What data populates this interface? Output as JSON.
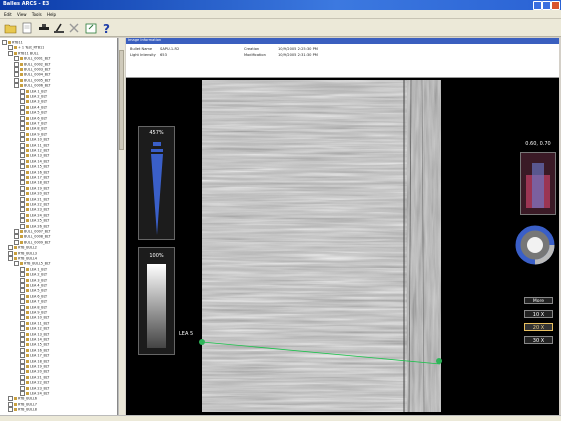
{
  "window": {
    "title": "Balles ARCS - E3"
  },
  "menu": [
    "Edit",
    "View",
    "Tools",
    "Help"
  ],
  "toolbar": {
    "icons": [
      "open-folder-icon",
      "new-document-icon",
      "stamp-icon",
      "tool-icon",
      "delete-icon",
      "export-icon",
      "help-icon"
    ]
  },
  "tree": {
    "items": [
      {
        "text": "RTB11",
        "indent": 0
      },
      {
        "text": "+ 1 Test_RTB11",
        "indent": 1
      },
      {
        "text": "RTB11 BULL",
        "indent": 1
      },
      {
        "text": "BULL_0001_BLT",
        "indent": 2
      },
      {
        "text": "BULL_0002_BLT",
        "indent": 2
      },
      {
        "text": "BULL_0003_BLT",
        "indent": 2
      },
      {
        "text": "BULL_0004_BLT",
        "indent": 2
      },
      {
        "text": "BULL_0005_BLT",
        "indent": 2
      },
      {
        "text": "BULL_0006_BLT",
        "indent": 2
      },
      {
        "text": "LEA 1_BLT",
        "indent": 3
      },
      {
        "text": "LEA 2_BLT",
        "indent": 3
      },
      {
        "text": "LEA 3_BLT",
        "indent": 3
      },
      {
        "text": "LEA 4_BLT",
        "indent": 3
      },
      {
        "text": "LEA 5_BLT",
        "indent": 3
      },
      {
        "text": "LEA 6_BLT",
        "indent": 3
      },
      {
        "text": "LEA 7_BLT",
        "indent": 3
      },
      {
        "text": "LEA 8_BLT",
        "indent": 3
      },
      {
        "text": "LEA 9_BLT",
        "indent": 3
      },
      {
        "text": "LEA 10_BLT",
        "indent": 3
      },
      {
        "text": "LEA 11_BLT",
        "indent": 3
      },
      {
        "text": "LEA 12_BLT",
        "indent": 3
      },
      {
        "text": "LEA 13_BLT",
        "indent": 3
      },
      {
        "text": "LEA 14_BLT",
        "indent": 3
      },
      {
        "text": "LEA 15_BLT",
        "indent": 3
      },
      {
        "text": "LEA 16_BLT",
        "indent": 3
      },
      {
        "text": "LEA 17_BLT",
        "indent": 3
      },
      {
        "text": "LEA 18_BLT",
        "indent": 3
      },
      {
        "text": "LEA 19_BLT",
        "indent": 3
      },
      {
        "text": "LEA 20_BLT",
        "indent": 3
      },
      {
        "text": "LEA 21_BLT",
        "indent": 3
      },
      {
        "text": "LEA 22_BLT",
        "indent": 3
      },
      {
        "text": "LEA 23_BLT",
        "indent": 3
      },
      {
        "text": "LEA 24_BLT",
        "indent": 3
      },
      {
        "text": "LEA 25_BLT",
        "indent": 3
      },
      {
        "text": "LEA 26_BLT",
        "indent": 3
      },
      {
        "text": "BULL_0007_BLT",
        "indent": 2
      },
      {
        "text": "BULL_0008_BLT",
        "indent": 2
      },
      {
        "text": "BULL_0009_BLT",
        "indent": 2
      },
      {
        "text": "RTB_BULL2",
        "indent": 1
      },
      {
        "text": "RTB_BULL3",
        "indent": 1
      },
      {
        "text": "RTB_BULL4",
        "indent": 1
      },
      {
        "text": "RTB_BULL5_BLT",
        "indent": 2
      },
      {
        "text": "LEA 1_BLT",
        "indent": 3
      },
      {
        "text": "LEA 2_BLT",
        "indent": 3
      },
      {
        "text": "LEA 3_BLT",
        "indent": 3
      },
      {
        "text": "LEA 4_BLT",
        "indent": 3
      },
      {
        "text": "LEA 5_BLT",
        "indent": 3
      },
      {
        "text": "LEA 6_BLT",
        "indent": 3
      },
      {
        "text": "LEA 7_BLT",
        "indent": 3
      },
      {
        "text": "LEA 8_BLT",
        "indent": 3
      },
      {
        "text": "LEA 9_BLT",
        "indent": 3
      },
      {
        "text": "LEA 10_BLT",
        "indent": 3
      },
      {
        "text": "LEA 11_BLT",
        "indent": 3
      },
      {
        "text": "LEA 12_BLT",
        "indent": 3
      },
      {
        "text": "LEA 13_BLT",
        "indent": 3
      },
      {
        "text": "LEA 14_BLT",
        "indent": 3
      },
      {
        "text": "LEA 15_BLT",
        "indent": 3
      },
      {
        "text": "LEA 16_BLT",
        "indent": 3
      },
      {
        "text": "LEA 17_BLT",
        "indent": 3
      },
      {
        "text": "LEA 18_BLT",
        "indent": 3
      },
      {
        "text": "LEA 19_BLT",
        "indent": 3
      },
      {
        "text": "LEA 20_BLT",
        "indent": 3
      },
      {
        "text": "LEA 21_BLT",
        "indent": 3
      },
      {
        "text": "LEA 22_BLT",
        "indent": 3
      },
      {
        "text": "LEA 23_BLT",
        "indent": 3
      },
      {
        "text": "LEA 24_BLT",
        "indent": 3
      },
      {
        "text": "RTB_BULL6",
        "indent": 1
      },
      {
        "text": "RTB_BULL7",
        "indent": 1
      },
      {
        "text": "RTB_BULL8",
        "indent": 1
      }
    ]
  },
  "info": {
    "header": "Image Information",
    "bullet_name_label": "Bullet Name",
    "bullet_name_value": "SAPU-1-R2",
    "light_intensity_label": "Light Intensity",
    "light_intensity_value": "653",
    "creation_label": "Creation",
    "creation_value": "10/9/2005 2:25:30 PM",
    "modification_label": "Modification",
    "modification_value": "10/9/2005 2:31:30 PM"
  },
  "viewer": {
    "zoom_percent_label": "457%",
    "zoom_level": 0.62,
    "brightness_label": "100%",
    "brightness_level": 1.0,
    "range_label": "0.60, 0.70",
    "lea_label": "LEA 5",
    "zoom_buttons": {
      "more": "More",
      "b1": "10 X",
      "b2": "20 X",
      "b3": "30 X"
    },
    "active_zoom": "20 X",
    "colors": {
      "profile_line": "#19c24a",
      "wedge": "#3a5fc8",
      "range_box": "#9b3553",
      "marker": "#2fb55a"
    }
  }
}
